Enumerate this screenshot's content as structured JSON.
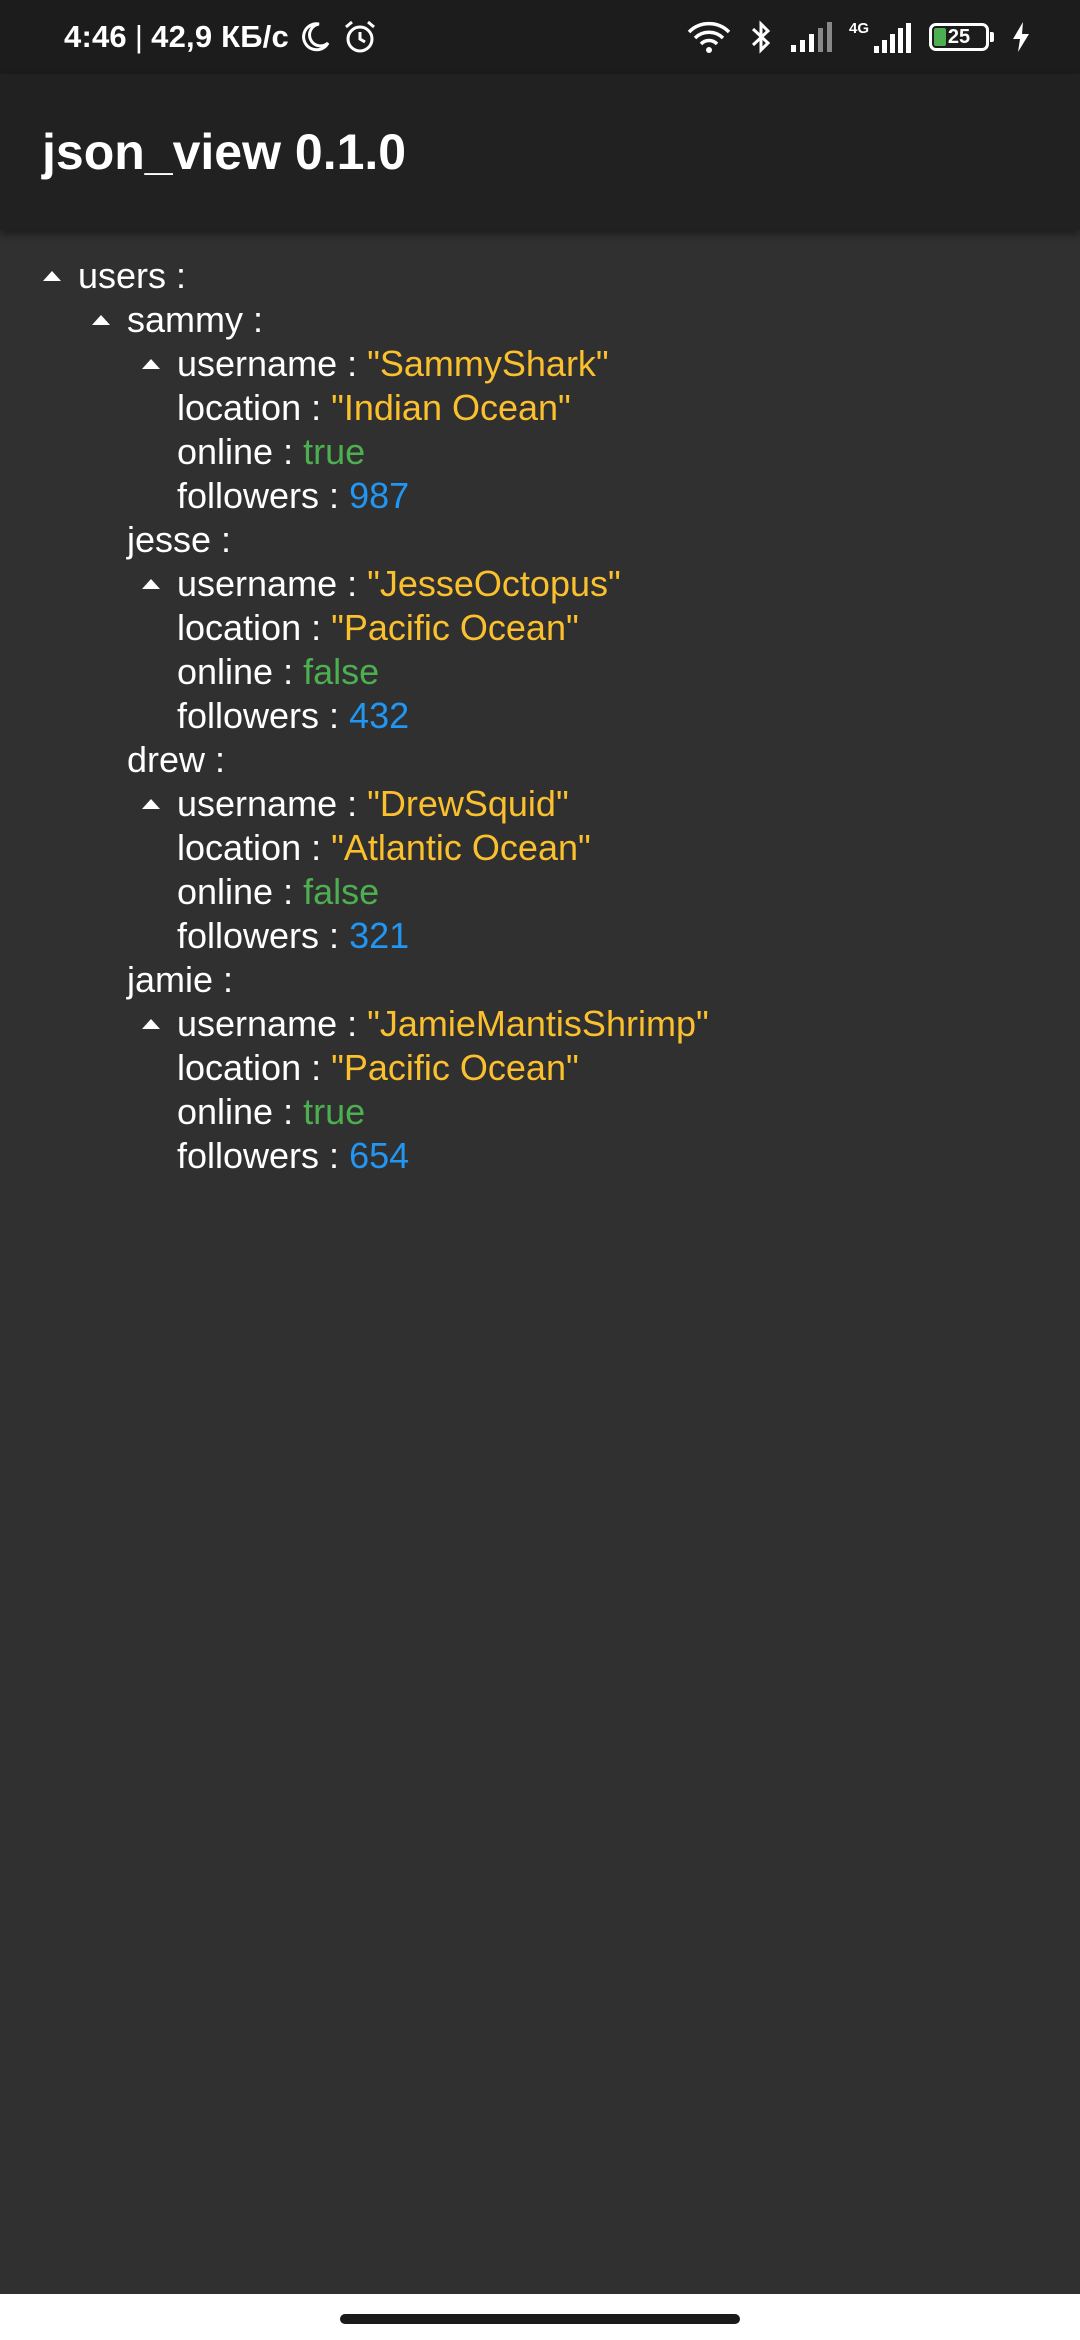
{
  "status_bar": {
    "time": "4:46",
    "separator": "|",
    "net_speed": "42,9 КБ/с",
    "network_label": "4G",
    "battery_level": "25",
    "icons": [
      "moon-icon",
      "alarm-icon",
      "wifi-icon",
      "bluetooth-icon",
      "signal-icon",
      "signal-4g-icon",
      "battery-icon",
      "charging-icon"
    ]
  },
  "app_bar": {
    "title": "json_view 0.1.0"
  },
  "colors": {
    "string": "#fbc02d",
    "boolean": "#4caf50",
    "number": "#2196f3",
    "key": "#ffffff",
    "background": "#303030",
    "app_bar": "#212121"
  },
  "tree": {
    "root_key": "users :",
    "users": [
      {
        "key": "sammy :",
        "username_key": "username : ",
        "username": "\"SammyShark\"",
        "location_key": "location : ",
        "location": "\"Indian Ocean\"",
        "online_key": "online : ",
        "online": "true",
        "followers_key": "followers : ",
        "followers": "987"
      },
      {
        "key": "jesse :",
        "username_key": "username : ",
        "username": "\"JesseOctopus\"",
        "location_key": "location : ",
        "location": "\"Pacific Ocean\"",
        "online_key": "online : ",
        "online": "false",
        "followers_key": "followers : ",
        "followers": "432"
      },
      {
        "key": "drew :",
        "username_key": "username : ",
        "username": "\"DrewSquid\"",
        "location_key": "location : ",
        "location": "\"Atlantic Ocean\"",
        "online_key": "online : ",
        "online": "false",
        "followers_key": "followers : ",
        "followers": "321"
      },
      {
        "key": "jamie :",
        "username_key": "username : ",
        "username": "\"JamieMantisShrimp\"",
        "location_key": "location : ",
        "location": "\"Pacific Ocean\"",
        "online_key": "online : ",
        "online": "true",
        "followers_key": "followers : ",
        "followers": "654"
      }
    ]
  }
}
